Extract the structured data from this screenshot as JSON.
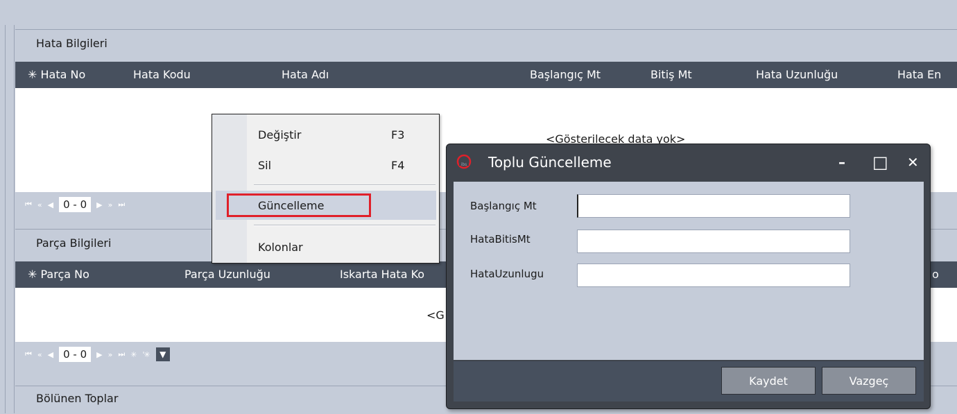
{
  "panels": {
    "hata": {
      "title": "Hata Bilgileri",
      "columns": [
        "✳ Hata No",
        "Hata Kodu",
        "Hata Adı",
        "Başlangıç Mt",
        "Bitiş Mt",
        "Hata Uzunluğu",
        "Hata En"
      ],
      "empty_text": "<Gösterilecek data yok>",
      "counter": "0 - 0"
    },
    "parca": {
      "title": "Parça Bilgileri",
      "columns": [
        "✳ Parça No",
        "Parça Uzunluğu",
        "Iskarta Hata Ko",
        "o"
      ],
      "empty_text": "<G",
      "counter": "0 - 0"
    },
    "bolunen": {
      "title": "Bölünen Toplar"
    }
  },
  "nav_icons": [
    "first-icon",
    "prev-page-icon",
    "prev-icon",
    "next-icon",
    "next-page-icon",
    "last-icon",
    "add-icon",
    "add-all-icon",
    "filter-icon"
  ],
  "nav_glyphs": {
    "first": "⏮",
    "prevpage": "«",
    "prev": "◀",
    "next": "▶",
    "nextpage": "»",
    "last": "⏭",
    "add": "✳",
    "addall": "'✳",
    "filter": "▼"
  },
  "context_menu": {
    "items": [
      {
        "label": "Değiştir",
        "shortcut": "F3"
      },
      {
        "label": "Sil",
        "shortcut": "F4"
      },
      {
        "label": "Güncelleme",
        "shortcut": ""
      },
      {
        "label": "Kolonlar",
        "shortcut": ""
      }
    ],
    "highlighted": "Güncelleme"
  },
  "dialog": {
    "title": "Toplu Güncelleme",
    "window_buttons": {
      "minimize": "–",
      "maximize": "□",
      "close": "✕"
    },
    "fields": [
      {
        "label": "Başlangıç Mt",
        "value": ""
      },
      {
        "label": "HataBitisMt",
        "value": ""
      },
      {
        "label": "HataUzunlugu",
        "value": ""
      }
    ],
    "buttons": {
      "save": "Kaydet",
      "cancel": "Vazgeç"
    }
  },
  "colors": {
    "header_bg": "#47505e",
    "panel_bg": "#c5ccd9",
    "highlight_border": "#e0202a",
    "logo": "#e0202a"
  }
}
